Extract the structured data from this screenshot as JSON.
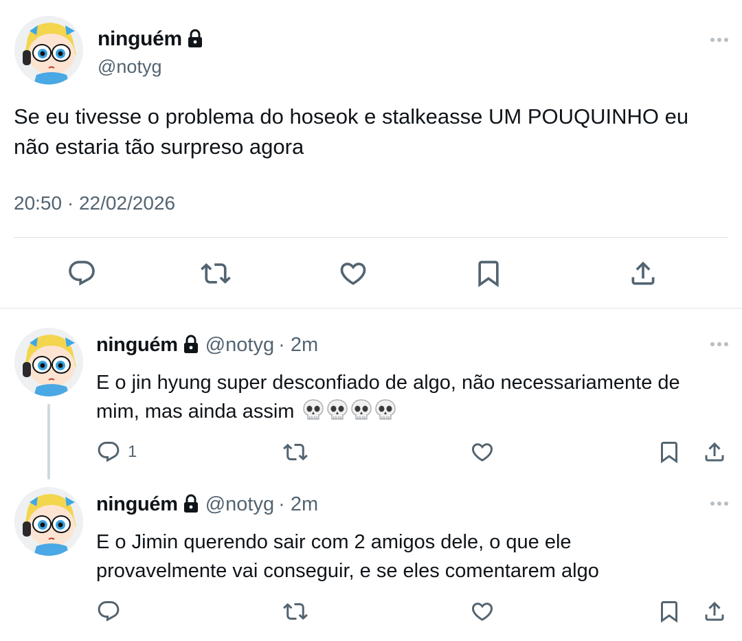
{
  "main_tweet": {
    "author_name": "ninguém",
    "handle": "@notyg",
    "text": "Se eu tivesse o problema do hoseok e stalkeasse UM POUQUINHO eu não estaria tão surpreso agora",
    "timestamp": "20:50 · 22/02/2026",
    "icons": [
      "reply-icon",
      "retweet-icon",
      "like-icon",
      "bookmark-icon",
      "share-icon"
    ]
  },
  "replies": [
    {
      "author_name": "ninguém",
      "handle": "@notyg",
      "time": "· 2m",
      "text": "E o jin hyung super desconfiado de algo, não necessariamente de mim, mas ainda assim",
      "emojis": "💀💀💀💀",
      "reply_count": "1"
    },
    {
      "author_name": "ninguém",
      "handle": "@notyg",
      "time": "· 2m",
      "text": "E o Jimin querendo sair com 2 amigos dele, o que ele provavelmente vai conseguir, e se eles comentarem algo",
      "reply_count": ""
    }
  ],
  "colors": {
    "text_primary": "#0f1419",
    "text_secondary": "#536471",
    "divider": "#dfe4e8",
    "thread_line": "#cfd9de"
  }
}
